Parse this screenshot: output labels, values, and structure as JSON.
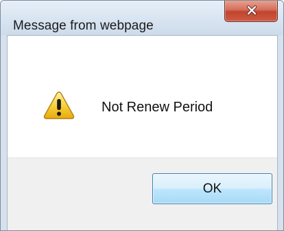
{
  "dialog": {
    "title": "Message from webpage",
    "message": "Not Renew Period",
    "ok_label": "OK",
    "icon": "warning-icon",
    "close_icon": "close-icon"
  },
  "colors": {
    "close_button": "#c1442e",
    "warning_fill": "#f5c518",
    "ok_button_border": "#3c7fb1"
  }
}
